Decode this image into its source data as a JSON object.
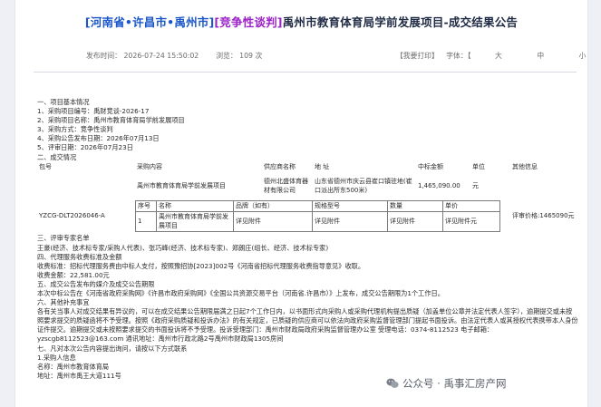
{
  "header": {
    "title_bracket_region": "[河南省•许昌市•禹州市]",
    "title_bracket_method": "[竞争性谈判]",
    "title_main": "禹州市教育体育局学前发展项目-成交结果公告",
    "publish_time": "发布时间： 2026-07-24 15:50:02",
    "views": "浏览： 109 次",
    "print_label": "【我要打印】",
    "font_label": "字体：【",
    "font_large": "大",
    "font_medium": "中",
    "font_small": "小",
    "font_close": "】"
  },
  "sections": {
    "s1": "一、项目基本情况",
    "s1_1": "1、采购项目编号：禹财竞谈-2026-17",
    "s1_2": "2、采购项目名称：禹州市教育体育局学前发展项目",
    "s1_3": "3、采购方式：竞争性谈判",
    "s1_4": "4、采购公告发布日期：2026年07月13日",
    "s1_5": "5、评审日期：2026年07月23日",
    "s2": "二、成交情况",
    "s3": "三、评审专家名单",
    "s3_1": "王豪(经济、技术标专家/采购人代表)、张巧峰(经济、技术标专家)、郑朗庄(组长、经济、技术标专家)",
    "s4": "四、代理服务收费标准及金额",
    "s4_1": "收费标准：招标代理服务费由中标人支付，按照豫招协[2023]002号《河南省招标代理服务收费指导意见》收取。",
    "s4_2": "收费金额：22,581.00元",
    "s5": "五、成交公告发布的媒介及成交公告期限",
    "s5_1": "本次中标公告在《河南省政府采购网》《许昌市政府采购网》《全国公共资源交易平台（河南省.许昌市）》上发布，成交公告期限为1个工作日。",
    "s6": "六、其他补充事宜",
    "s6_1": "各有关当事人对成交结果有异议的，可以在成交结果公告期限届满之日起7个工作日内，以书面形式向采购人或采购代理机构提出质疑（加盖单位公章并法定代表人签字），逾期提交或未按照要求提交的质疑函将不予受理。按照《政府采购质疑和投诉办法》的有关规定，已质疑的供应商可以依法向政府采购监督管理部门提起书面投诉。由法定代表人或其授权代表携带本人身份证件提交。逾期提交或未按照要求提交的书面投诉将不予受理。投诉受理部门：禹州市财政局政府采购监督管理办公室 受理电话：0374-8112523 电子邮箱：yzscgb8112523@163.com 通讯地址：禹州市行政北路2号禹州市财政局1305房间",
    "s7": "七、凡对本次公告内容提出询问，请按以下方式联系",
    "s7_1": "1.采购人信息",
    "s7_2": "名称：禹州市教育体育局",
    "s7_3": "地址：禹州市禹王大道111号"
  },
  "award_table": {
    "headers": {
      "package": "包号",
      "content": "采购内容",
      "supplier": "供应商名称",
      "address": "地 址",
      "amount": "中标金额",
      "unit": "单位",
      "other": "其他信息"
    },
    "row": {
      "content": "禹州市教育体育局学前发展项目",
      "supplier": "德州北盛体育器材有限公司",
      "address": "山东省德州市庆云县崔口镇驻地(崔口派出所东500米)",
      "amount": "1,465,090.00",
      "unit": "元",
      "package": "YZCG-DLT2026046-A",
      "review_price": "评审价格:1465090元"
    },
    "inner_headers": {
      "seq": "序号",
      "name": "名称",
      "brand": "品牌（如有）",
      "spec": "规格型号",
      "qty": "数量",
      "price": "单价"
    },
    "inner_row": {
      "seq": "1",
      "name": "禹州市教育体育局学前发展项目",
      "brand": "详见附件",
      "spec": "详见附件",
      "qty": "详见附件",
      "price": "详见附件元"
    }
  },
  "watermark": {
    "text": "公众号 · 禹事汇房产网"
  }
}
